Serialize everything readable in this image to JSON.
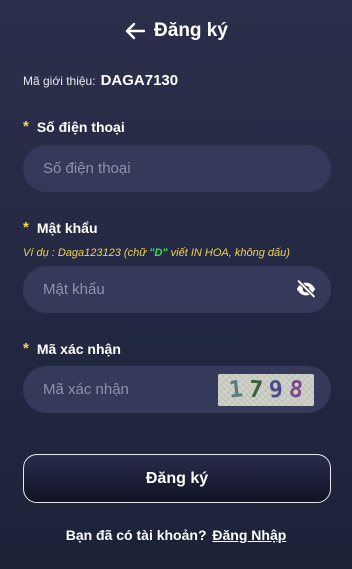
{
  "header": {
    "title": "Đăng ký",
    "back_icon": "arrow-left-icon"
  },
  "referral": {
    "label": "Mã giới thiệu:",
    "code": "DAGA7130"
  },
  "phone": {
    "star": "*",
    "label": "Số điện thoại",
    "placeholder": "Số điện thoại",
    "value": ""
  },
  "password": {
    "star": "*",
    "label": "Mật khẩu",
    "hint_prefix": "Ví dụ : Daga123123 (chữ ",
    "hint_letter": "\"D\"",
    "hint_suffix": " viết IN HOA, không dấu)",
    "placeholder": "Mật khẩu",
    "value": "",
    "toggle_icon": "eye-off-icon"
  },
  "captcha": {
    "star": "*",
    "label": "Mã xác nhận",
    "placeholder": "Mã xác nhận",
    "value": "",
    "digits": [
      "1",
      "7",
      "9",
      "8"
    ],
    "digit_colors": [
      "#5a7a82",
      "#3b5f3b",
      "#4a4a8a",
      "#7a4a8a"
    ]
  },
  "submit": {
    "label": "Đăng ký"
  },
  "footer": {
    "question": "Bạn đã có tài khoản?",
    "link": "Đăng Nhập"
  },
  "colors": {
    "accent_star": "#f6d94a",
    "hint": "#f2d34a",
    "hint_highlight": "#37d94a",
    "field_bg": "#363a5a"
  }
}
